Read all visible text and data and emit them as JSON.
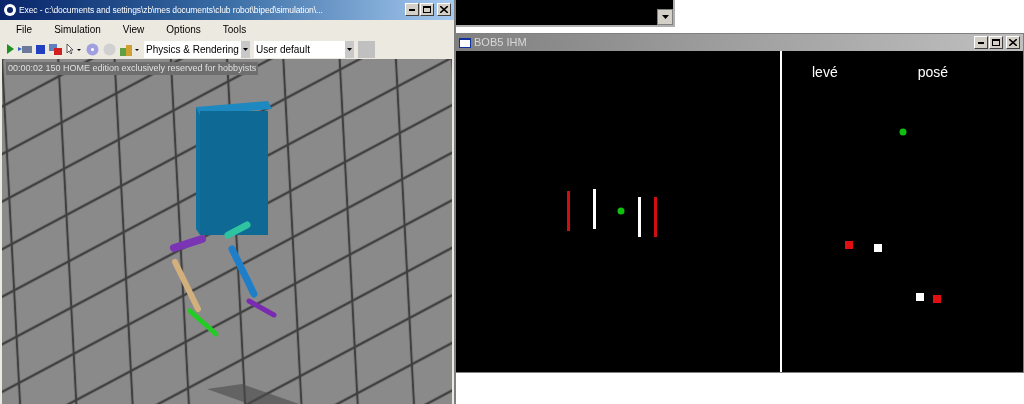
{
  "exec_window": {
    "title": "Exec - c:\\documents and settings\\zb\\mes documents\\club robot\\biped\\simulation\\...",
    "menu": [
      "File",
      "Simulation",
      "View",
      "Options",
      "Tools"
    ],
    "dropdowns": [
      {
        "value": "Physics & Rendering"
      },
      {
        "value": "User default"
      }
    ],
    "overlay_text": "00:00:02 150 HOME edition exclusively reserved for hobbyists"
  },
  "ihm_window": {
    "title": "BOB5 IHM",
    "labels": [
      "levé",
      "posé"
    ]
  }
}
